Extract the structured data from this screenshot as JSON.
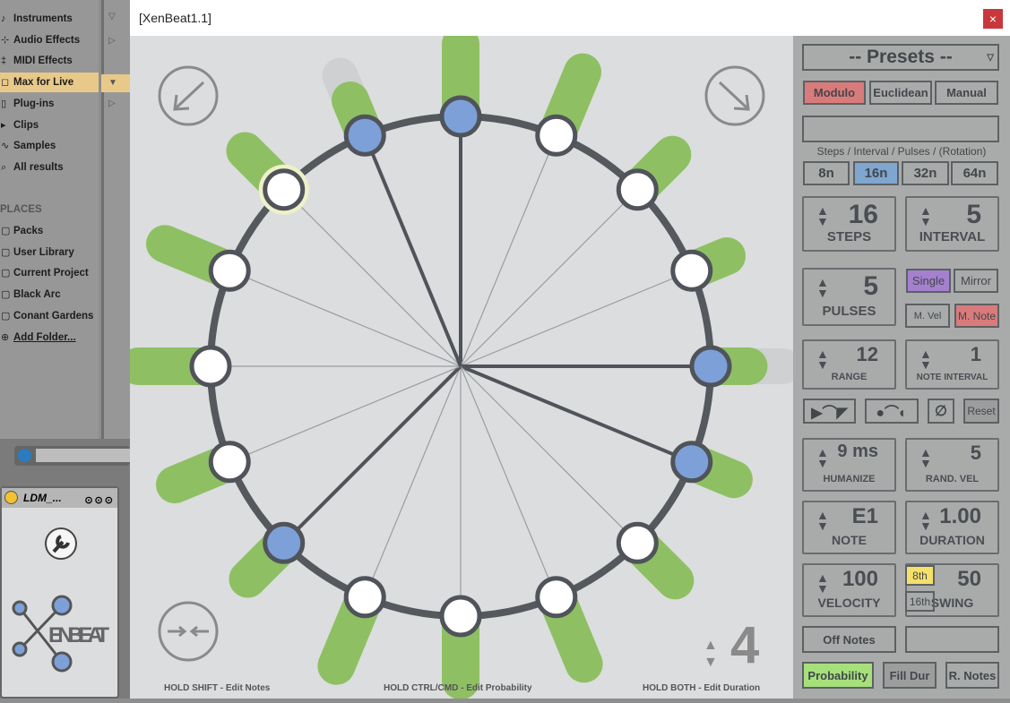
{
  "browser": {
    "items": [
      {
        "label": "Instruments",
        "icon": "♪"
      },
      {
        "label": "Audio Effects",
        "icon": "⊹"
      },
      {
        "label": "MIDI Effects",
        "icon": "‡"
      },
      {
        "label": "Max for Live",
        "icon": "◻",
        "selected": true
      },
      {
        "label": "Plug-ins",
        "icon": "▯"
      },
      {
        "label": "Clips",
        "icon": "▸"
      },
      {
        "label": "Samples",
        "icon": "∿"
      },
      {
        "label": "All results",
        "icon": "⌕"
      }
    ],
    "places_heading": "PLACES",
    "places": [
      {
        "label": "Packs"
      },
      {
        "label": "User Library"
      },
      {
        "label": "Current Project"
      },
      {
        "label": "Black Arc"
      },
      {
        "label": "Conant Gardens"
      },
      {
        "label": "Add Folder..."
      }
    ]
  },
  "device": {
    "name": "LDM_...",
    "logo_text": "ENBEAT"
  },
  "window": {
    "title": "[XenBeat1.1]",
    "close": "×"
  },
  "sequencer": {
    "steps_count": 16,
    "pulse_color": "#7da0d8",
    "prob_color": "#8ec063",
    "steps": [
      {
        "pulse": true,
        "probability": 0.95
      },
      {
        "pulse": false,
        "probability": 0.9
      },
      {
        "pulse": false,
        "probability": 0.65
      },
      {
        "pulse": false,
        "probability": 0.5
      },
      {
        "pulse": true,
        "probability": 0.5,
        "extra": 0.95
      },
      {
        "pulse": true,
        "probability": 0.6
      },
      {
        "pulse": false,
        "probability": 0.7
      },
      {
        "pulse": false,
        "probability": 0.95
      },
      {
        "pulse": false,
        "probability": 0.85
      },
      {
        "pulse": false,
        "probability": 0.98
      },
      {
        "pulse": true,
        "probability": 0.67
      },
      {
        "pulse": false,
        "probability": 0.78
      },
      {
        "pulse": false,
        "probability": 0.95
      },
      {
        "pulse": false,
        "probability": 0.92
      },
      {
        "pulse": false,
        "probability": 0.72
      },
      {
        "pulse": true,
        "probability": 0.5,
        "extra": 0.85
      }
    ],
    "highlighted_step": 14,
    "rotation": "4",
    "hints": [
      "HOLD SHIFT - Edit Notes",
      "HOLD CTRL/CMD - Edit Probability",
      "HOLD BOTH - Edit Duration"
    ]
  },
  "panel": {
    "presets": "-- Presets --",
    "modes": [
      "Modulo",
      "Euclidean",
      "Manual"
    ],
    "active_mode": "Modulo",
    "pattern_text": "",
    "pattern_caption": "Steps / Interval / Pulses / (Rotation)",
    "rates": [
      "8n",
      "16n",
      "32n",
      "64n"
    ],
    "active_rate": "16n",
    "steps": {
      "value": "16",
      "label": "STEPS"
    },
    "interval": {
      "value": "5",
      "label": "INTERVAL"
    },
    "pulses": {
      "value": "5",
      "label": "PULSES"
    },
    "single": "Single",
    "mirror": "Mirror",
    "mvel": "M. Vel",
    "mnote": "M. Note",
    "range": {
      "value": "12",
      "label": "RANGE"
    },
    "note_interval": {
      "value": "1",
      "label": "NOTE INTERVAL"
    },
    "reset": "Reset",
    "humanize": {
      "value": "9 ms",
      "label": "HUMANIZE"
    },
    "rand_vel": {
      "value": "5",
      "label": "RAND. VEL"
    },
    "note": {
      "value": "E1",
      "label": "NOTE"
    },
    "duration": {
      "value": "1.00",
      "label": "DURATION"
    },
    "velocity": {
      "value": "100",
      "label": "VELOCITY"
    },
    "swing": {
      "value": "50",
      "label": "SWING",
      "opt1": "8th",
      "opt2": "16th"
    },
    "off_notes": "Off Notes",
    "off_notes_field": "",
    "probability": "Probability",
    "fill_dur": "Fill Dur",
    "r_notes": "R. Notes",
    "colors": {
      "modulo": "#d97b7b",
      "rate": "#7ea6cf",
      "single": "#a580cf",
      "mnote": "#d97b7b",
      "eighth": "#f5e06a",
      "probability": "#a6e07b"
    }
  }
}
